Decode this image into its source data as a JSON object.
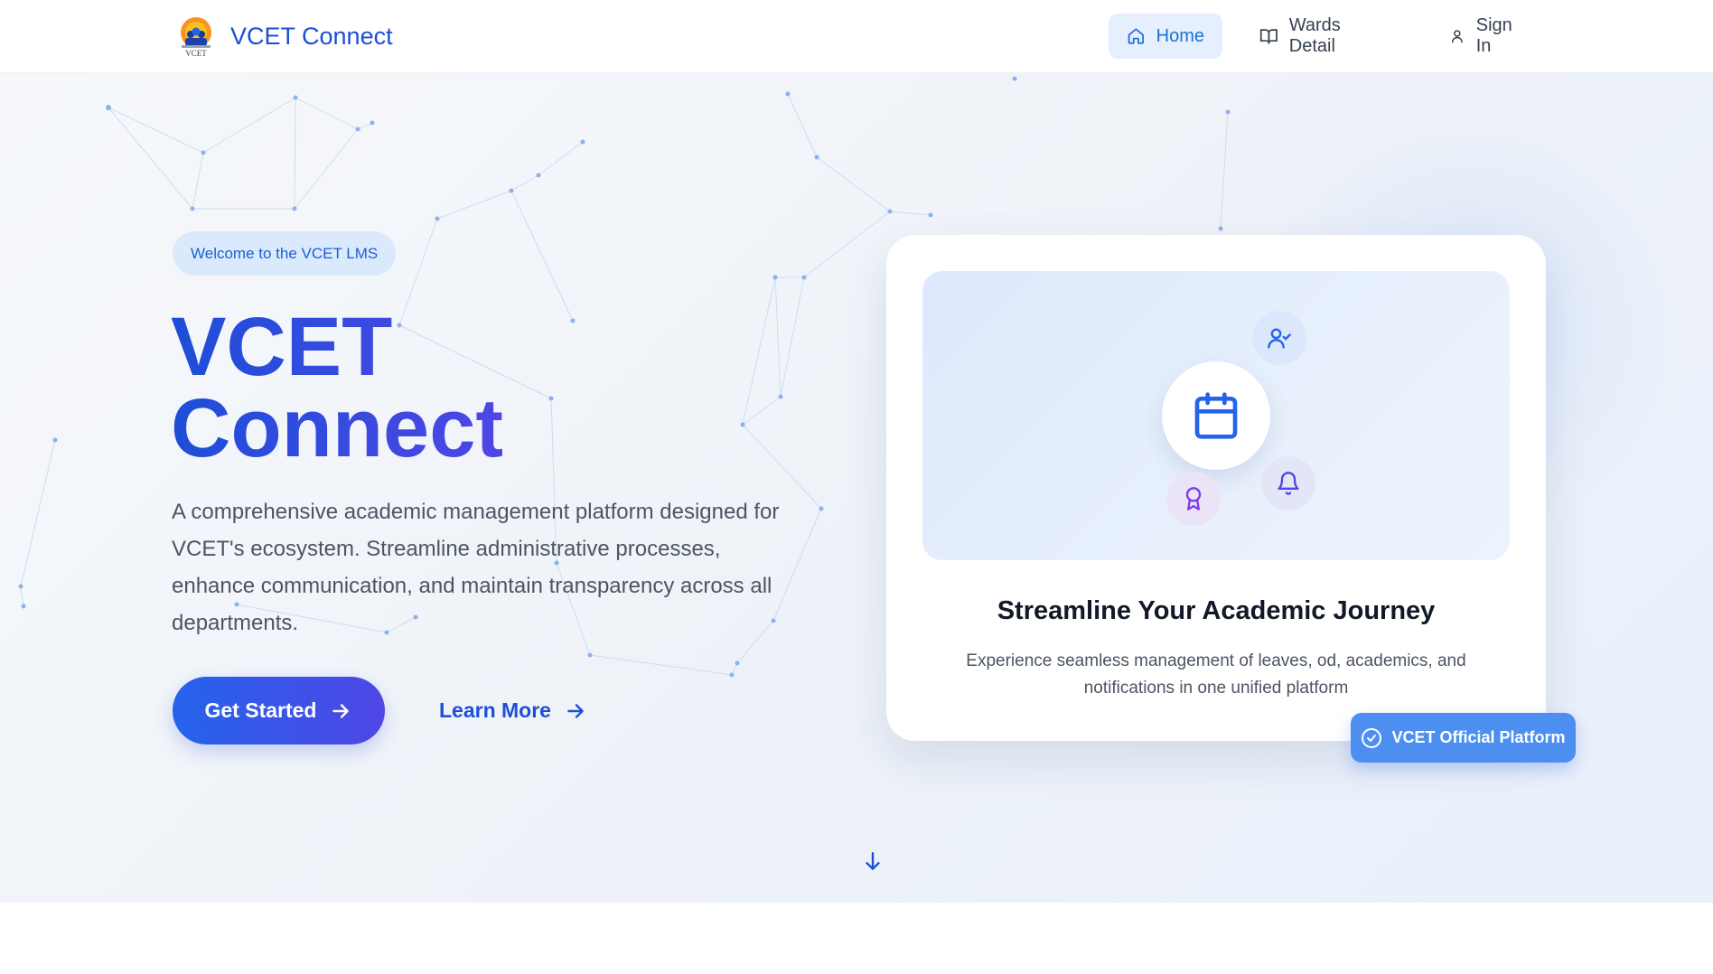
{
  "brand": {
    "name": "VCET Connect",
    "logo_text": "VCET"
  },
  "nav": {
    "items": [
      {
        "label": "Home",
        "icon": "home-icon",
        "active": true
      },
      {
        "label": "Wards Detail",
        "icon": "book-open-icon",
        "active": false
      },
      {
        "label": "Sign In",
        "icon": "user-icon",
        "active": false
      }
    ]
  },
  "hero": {
    "pill": "Welcome to the VCET LMS",
    "title_line1": "VCET",
    "title_line2": "Connect",
    "description": "A comprehensive academic management platform designed for VCET's ecosystem. Streamline administrative processes, enhance communication, and maintain transparency across all departments.",
    "primary_button": "Get Started",
    "secondary_button": "Learn More"
  },
  "card": {
    "title": "Streamline Your Academic Journey",
    "text": "Experience seamless management of leaves, od, academics, and notifications in one unified platform",
    "icons": [
      "calendar-icon",
      "user-check-icon",
      "bell-icon",
      "award-icon"
    ]
  },
  "badge": {
    "label": "VCET Official Platform",
    "icon": "check-circle-icon"
  },
  "colors": {
    "primary": "#2563eb",
    "indigo": "#4f46e5",
    "badge": "#4d8ff0",
    "nav_active_bg": "#e5effd"
  }
}
